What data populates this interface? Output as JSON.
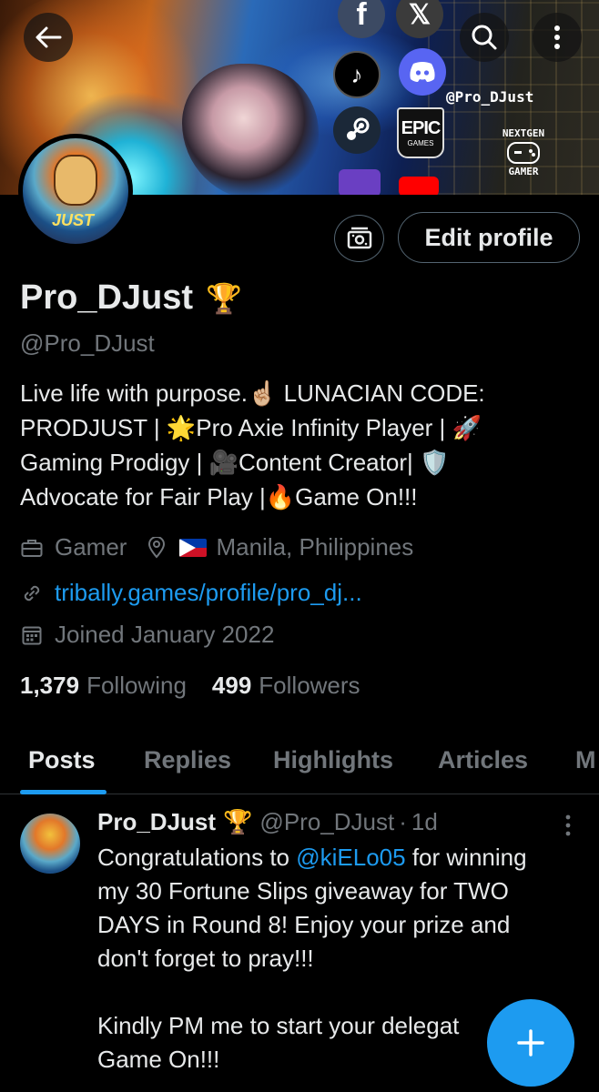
{
  "banner": {
    "handle": "@Pro_DJust",
    "nextgen_top": "NEXTGEN",
    "nextgen_bottom": "GAMER",
    "epic_top": "EPIC",
    "epic_bottom": "GAMES"
  },
  "header": {
    "back_icon": "back-arrow-icon",
    "search_icon": "search-icon",
    "more_icon": "more-vertical-icon"
  },
  "actions": {
    "subscriptions_icon": "subscriptions-icon",
    "edit_profile_label": "Edit profile"
  },
  "profile": {
    "name": "Pro_DJust",
    "badge_emoji": "🏆",
    "handle": "@Pro_DJust",
    "bio_lines": [
      "Live life with purpose.☝🏼 LUNACIAN CODE:",
      "PRODJUST | 🌟Pro Axie Infinity Player | 🚀",
      "Gaming Prodigy | 🎥Content Creator| 🛡️",
      "Advocate for Fair Play |🔥Game On!!!"
    ],
    "category": "Gamer",
    "location": "Manila, Philippines",
    "website": "tribally.games/profile/pro_dj...",
    "joined": "Joined January 2022",
    "following_count": "1,379",
    "following_label": "Following",
    "followers_count": "499",
    "followers_label": "Followers"
  },
  "tabs": [
    {
      "label": "Posts",
      "active": true
    },
    {
      "label": "Replies",
      "active": false
    },
    {
      "label": "Highlights",
      "active": false
    },
    {
      "label": "Articles",
      "active": false
    },
    {
      "label": "M",
      "active": false
    }
  ],
  "post": {
    "author_name": "Pro_DJust",
    "author_badge": "🏆",
    "author_handle": "@Pro_DJust",
    "separator": "·",
    "time": "1d",
    "text_1a": "Congratulations to ",
    "mention": "@kiELo05",
    "text_1b": " for winning",
    "line_2": "my 30 Fortune Slips giveaway for TWO",
    "line_3": "DAYS in Round 8! Enjoy your prize and",
    "line_4": "don't forget to pray!!!",
    "line_5": "Kindly PM me to start your delegat",
    "line_6": "Game On!!!"
  },
  "fab": {
    "icon": "plus-icon"
  },
  "colors": {
    "background": "#000000",
    "text_primary": "#e7e9ea",
    "text_secondary": "#71767b",
    "accent": "#1d9bf0",
    "border": "#2f3336"
  }
}
